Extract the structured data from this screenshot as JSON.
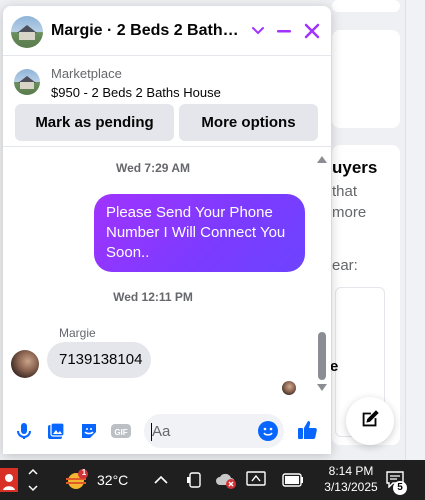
{
  "chat": {
    "title": "Margie · 2 Beds 2 Baths H...",
    "listing_label": "Marketplace",
    "listing_name": "$950 - 2 Beds 2 Baths House",
    "mark_pending_label": "Mark as pending",
    "more_options_label": "More options"
  },
  "messages": {
    "timestamp_1": "Wed 7:29 AM",
    "outgoing_text": "Please Send Your Phone Number I Will Connect You Soon..",
    "timestamp_2": "Wed 12:11 PM",
    "sender_name": "Margie",
    "incoming_text": "7139138104"
  },
  "composer": {
    "placeholder": "Aa"
  },
  "background": {
    "partial_title": "uyers",
    "partial_line_1": "that",
    "partial_line_2": "more",
    "partial_line_3": "ear:",
    "partial_bold": "e"
  },
  "taskbar": {
    "weather_badge": "1",
    "temperature": "32°C",
    "time": "8:14 PM",
    "date": "3/13/2025",
    "notification_count": "5"
  },
  "colors": {
    "accent": "#a033ff",
    "messenger_blue": "#0866ff",
    "header_icon": "#a033ff"
  },
  "icons": [
    "minimize-icon",
    "close-icon",
    "chevron-down-icon",
    "mic-icon",
    "photo-icon",
    "sticker-icon",
    "gif-icon",
    "emoji-icon",
    "like-icon",
    "compose-icon"
  ]
}
